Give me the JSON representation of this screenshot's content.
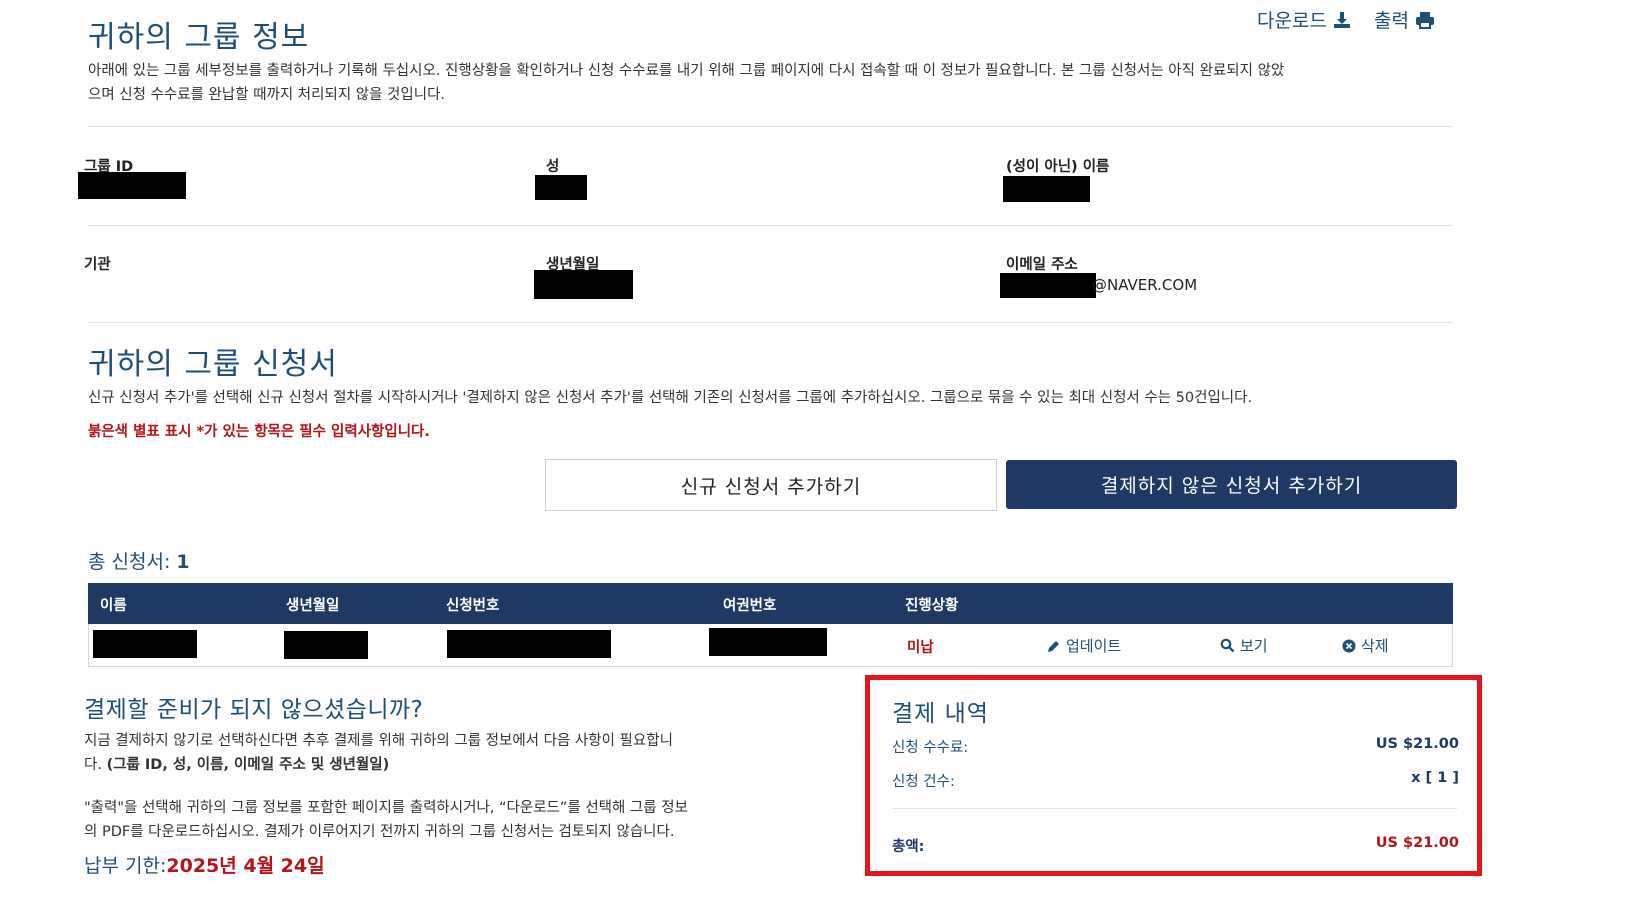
{
  "top_actions": {
    "download_label": "다운로드",
    "download_icon": "download-icon",
    "print_label": "출력",
    "print_icon": "print-icon"
  },
  "group_info": {
    "title": "귀하의 그룹 정보",
    "description_line1": "아래에 있는 그룹 세부정보를 출력하거나 기록해 두십시오. 진행상황을 확인하거나 신청 수수료를 내기 위해 그룹 페이지에 다시 접속할 때 이 정보가 필요합니다. 본 그룹 신청서는 아직 완료되지 않았",
    "description_line2": "으며 신청 수수료를 완납할 때까지 처리되지 않을 것입니다.",
    "group_id_label": "그룹 ID",
    "surname_label": "성",
    "given_name_label": "(성이 아닌) 이름",
    "institution_label": "기관",
    "birthdate_label": "생년월일",
    "email_label": "이메일 주소",
    "email_suffix": "@NAVER.COM"
  },
  "applications": {
    "title": "귀하의 그룹 신청서",
    "description": "신규 신청서 추가'를 선택해 신규 신청서 절차를 시작하시거나 '결제하지 않은 신청서 추가'를 선택해 기존의 신청서를 그룹에 추가하십시오. 그룹으로 묶을 수 있는 최대 신청서 수는 50건입니다.",
    "required_note": "붉은색 별표 표시 *가 있는 항목은 필수 입력사항입니다.",
    "add_new_button": "신규 신청서 추가하기",
    "add_unpaid_button": "결제하지 않은 신청서 추가하기",
    "total_label": "총 신청서:",
    "total_count": "1",
    "table": {
      "headers": [
        "이름",
        "생년월일",
        "신청번호",
        "여권번호",
        "진행상황"
      ],
      "rows": [
        {
          "status": "미납",
          "update": "업데이트",
          "view": "보기",
          "delete": "삭제"
        }
      ]
    }
  },
  "not_ready": {
    "title": "결제할 준비가 되지 않으셨습니까?",
    "para1_line1": "지금 결제하지 않기로 선택하신다면 추후 결제를 위해 귀하의 그룹 정보에서 다음 사항이 필요합니",
    "para1_line2_prefix": "다. ",
    "para1_line2_bold": "(그룹 ID, 성, 이름, 이메일 주소 및 생년월일)",
    "para2_line1": "\"출력\"을 선택해 귀하의 그룹 정보를 포함한 페이지를 출력하시거나, “다운로드”를 선택해 그룹 정보",
    "para2_line2": "의 PDF를 다운로드하십시오. 결제가 이루어지기 전까지 귀하의 그룹 신청서는 검토되지 않습니다.",
    "deadline_label": "납부 기한:",
    "deadline_value": "2025년 4월 24일"
  },
  "payment_summary": {
    "title": "결제 내역",
    "fee_label": "신청 수수료:",
    "fee_value": "US $21.00",
    "count_label": "신청 건수:",
    "count_value": "x [ 1 ]",
    "total_label": "총액:",
    "total_value": "US $21.00"
  },
  "colors": {
    "navy": "#1e3a64",
    "heading_blue": "#1f4e79",
    "red": "#b41419",
    "highlight_red": "#e3141c"
  }
}
